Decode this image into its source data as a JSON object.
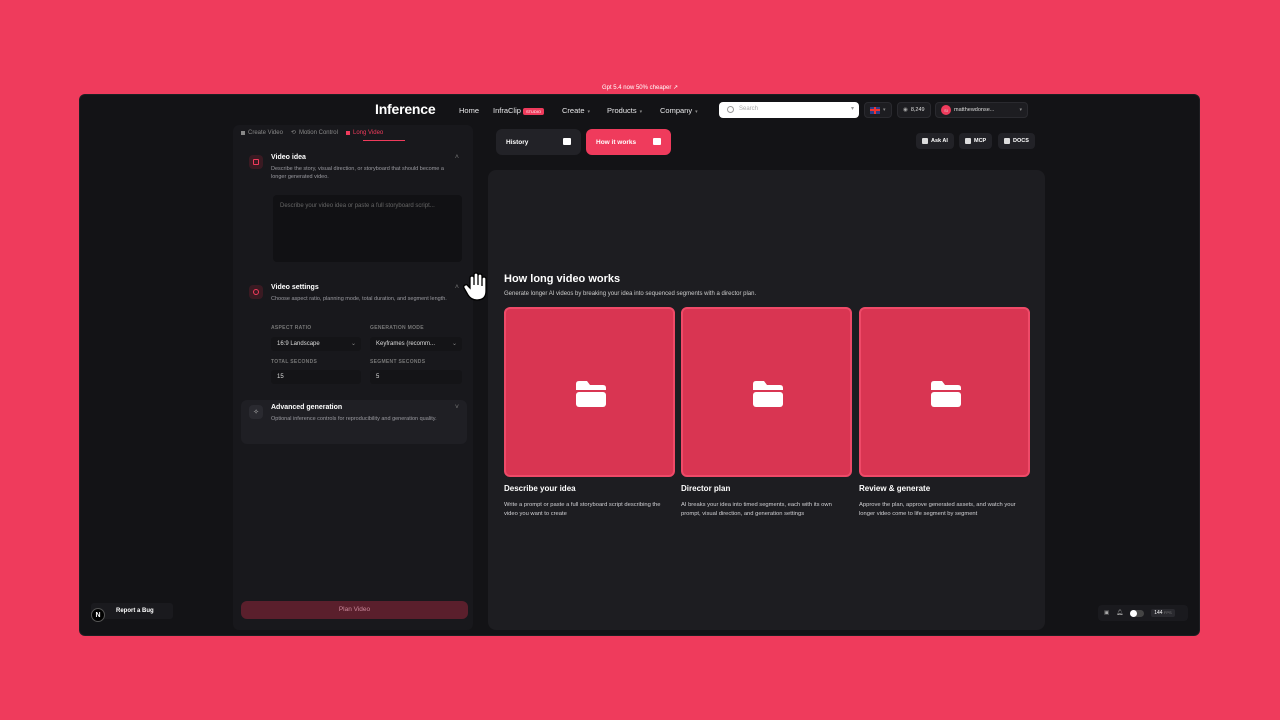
{
  "promo": {
    "text": "Gpt 5.4 now 50% cheaper ↗"
  },
  "nav": {
    "logo": "Inference",
    "home": "Home",
    "infraclip": "InfraClip",
    "infraclip_badge": "STUDIO",
    "create": "Create",
    "products": "Products",
    "company": "Company",
    "search_placeholder": "Search",
    "credits": "8,249",
    "avatar_initials": "SI",
    "username": "matthewdonse..."
  },
  "tabs": [
    {
      "label": "Create Video"
    },
    {
      "label": "Motion Control"
    },
    {
      "label": "Long Video"
    }
  ],
  "video_idea": {
    "title": "Video idea",
    "description": "Describe the story, visual direction, or storyboard that should become a longer generated video.",
    "placeholder": "Describe your video idea or paste a full storyboard script..."
  },
  "video_settings": {
    "title": "Video settings",
    "description": "Choose aspect ratio, planning mode, total duration, and segment length.",
    "aspect_ratio_label": "ASPECT RATIO",
    "aspect_ratio_value": "16:9 Landscape",
    "generation_mode_label": "GENERATION MODE",
    "generation_mode_value": "Keyframes (recomm...",
    "total_seconds_label": "TOTAL SECONDS",
    "total_seconds_value": "15",
    "segment_seconds_label": "SEGMENT SECONDS",
    "segment_seconds_value": "5"
  },
  "advanced": {
    "title": "Advanced generation",
    "description": "Optional inference controls for reproducibility and generation quality."
  },
  "plan_button": "Plan Video",
  "toolbar": {
    "history": "History",
    "how_it_works": "How it works",
    "ask_ai": "Ask AI",
    "mcp": "MCP",
    "docs": "DOCS"
  },
  "how": {
    "title": "How long video works",
    "subtitle": "Generate longer AI videos by breaking your idea into sequenced segments with a director plan.",
    "cards": [
      {
        "title": "Describe your idea",
        "description": "Write a prompt or paste a full storyboard script describing the video you want to create"
      },
      {
        "title": "Director plan",
        "description": "AI breaks your idea into timed segments, each with its own prompt, visual direction, and generation settings"
      },
      {
        "title": "Review & generate",
        "description": "Approve the plan, approve generated assets, and watch your longer video come to life segment by segment"
      }
    ]
  },
  "report_bug": "Report a Bug",
  "next_badge": "N",
  "status": {
    "fps": "144",
    "fps_unit": "FPS"
  },
  "colors": {
    "accent": "#ef3b5c",
    "background": "#ef3b5c",
    "panel": "#18181c"
  }
}
